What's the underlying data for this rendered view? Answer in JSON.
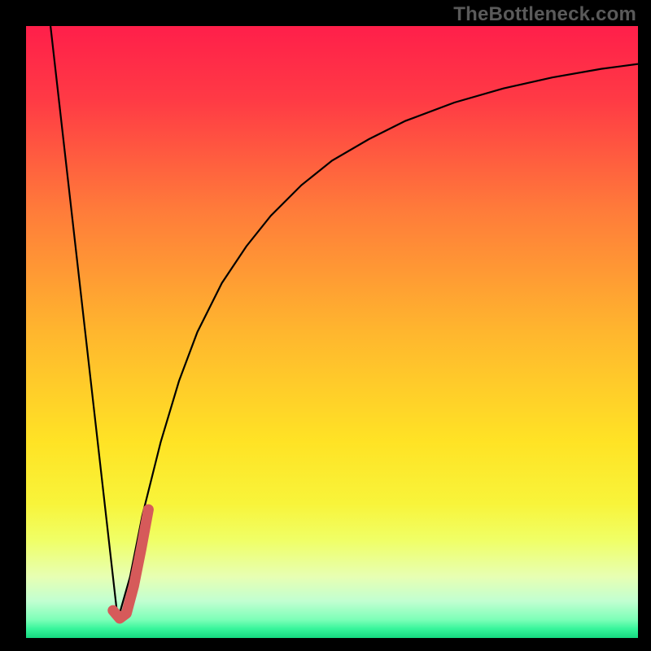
{
  "watermark": {
    "text": "TheBottleneck.com"
  },
  "chart_data": {
    "type": "line",
    "title": "",
    "xlabel": "",
    "ylabel": "",
    "xlim": [
      0,
      100
    ],
    "ylim": [
      0,
      100
    ],
    "grid": false,
    "legend": false,
    "gradient_stops": [
      {
        "pct": 0,
        "color": "#ff1f4a"
      },
      {
        "pct": 12,
        "color": "#ff3a45"
      },
      {
        "pct": 30,
        "color": "#ff7b3a"
      },
      {
        "pct": 50,
        "color": "#ffb62e"
      },
      {
        "pct": 68,
        "color": "#ffe325"
      },
      {
        "pct": 78,
        "color": "#f8f43a"
      },
      {
        "pct": 84,
        "color": "#f0ff66"
      },
      {
        "pct": 90,
        "color": "#e7ffb3"
      },
      {
        "pct": 94,
        "color": "#c1ffd1"
      },
      {
        "pct": 97,
        "color": "#7dffb8"
      },
      {
        "pct": 98.5,
        "color": "#37f59b"
      },
      {
        "pct": 100,
        "color": "#15d880"
      }
    ],
    "series": [
      {
        "name": "descending-line",
        "stroke": "#000000",
        "width": 2.2,
        "x": [
          4,
          15
        ],
        "y": [
          100,
          3
        ]
      },
      {
        "name": "rising-curve",
        "stroke": "#000000",
        "width": 2.2,
        "x": [
          15,
          17,
          19,
          22,
          25,
          28,
          32,
          36,
          40,
          45,
          50,
          56,
          62,
          70,
          78,
          86,
          94,
          100
        ],
        "y": [
          3,
          10,
          20,
          32,
          42,
          50,
          58,
          64,
          69,
          74,
          78,
          81.5,
          84.5,
          87.5,
          89.8,
          91.6,
          93,
          93.8
        ]
      },
      {
        "name": "hook-marker",
        "stroke": "#d65a5a",
        "width": 13,
        "linecap": "round",
        "x": [
          14.2,
          15.3,
          16.4,
          17.6,
          18.8,
          20.0
        ],
        "y": [
          4.5,
          3.2,
          4.0,
          8.5,
          14.5,
          21.0
        ]
      }
    ]
  }
}
